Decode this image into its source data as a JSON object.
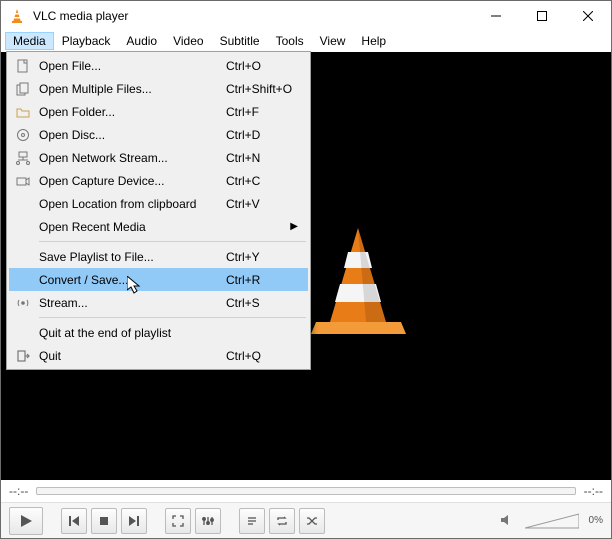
{
  "titlebar": {
    "title": "VLC media player"
  },
  "menubar": {
    "items": [
      "Media",
      "Playback",
      "Audio",
      "Video",
      "Subtitle",
      "Tools",
      "View",
      "Help"
    ],
    "active_index": 0
  },
  "dropdown": {
    "items": [
      {
        "icon": "file",
        "label": "Open File...",
        "shortcut": "Ctrl+O"
      },
      {
        "icon": "files",
        "label": "Open Multiple Files...",
        "shortcut": "Ctrl+Shift+O"
      },
      {
        "icon": "folder",
        "label": "Open Folder...",
        "shortcut": "Ctrl+F"
      },
      {
        "icon": "disc",
        "label": "Open Disc...",
        "shortcut": "Ctrl+D"
      },
      {
        "icon": "network",
        "label": "Open Network Stream...",
        "shortcut": "Ctrl+N"
      },
      {
        "icon": "capture",
        "label": "Open Capture Device...",
        "shortcut": "Ctrl+C"
      },
      {
        "icon": "",
        "label": "Open Location from clipboard",
        "shortcut": "Ctrl+V"
      },
      {
        "icon": "",
        "label": "Open Recent Media",
        "shortcut": "",
        "submenu": true
      },
      {
        "sep": true
      },
      {
        "icon": "",
        "label": "Save Playlist to File...",
        "shortcut": "Ctrl+Y"
      },
      {
        "icon": "",
        "label": "Convert / Save...",
        "shortcut": "Ctrl+R",
        "hover": true
      },
      {
        "icon": "stream",
        "label": "Stream...",
        "shortcut": "Ctrl+S"
      },
      {
        "sep": true
      },
      {
        "icon": "",
        "label": "Quit at the end of playlist",
        "shortcut": ""
      },
      {
        "icon": "quit",
        "label": "Quit",
        "shortcut": "Ctrl+Q"
      }
    ]
  },
  "timebar": {
    "left": "--:--",
    "right": "--:--"
  },
  "volume": {
    "label": "0%"
  }
}
